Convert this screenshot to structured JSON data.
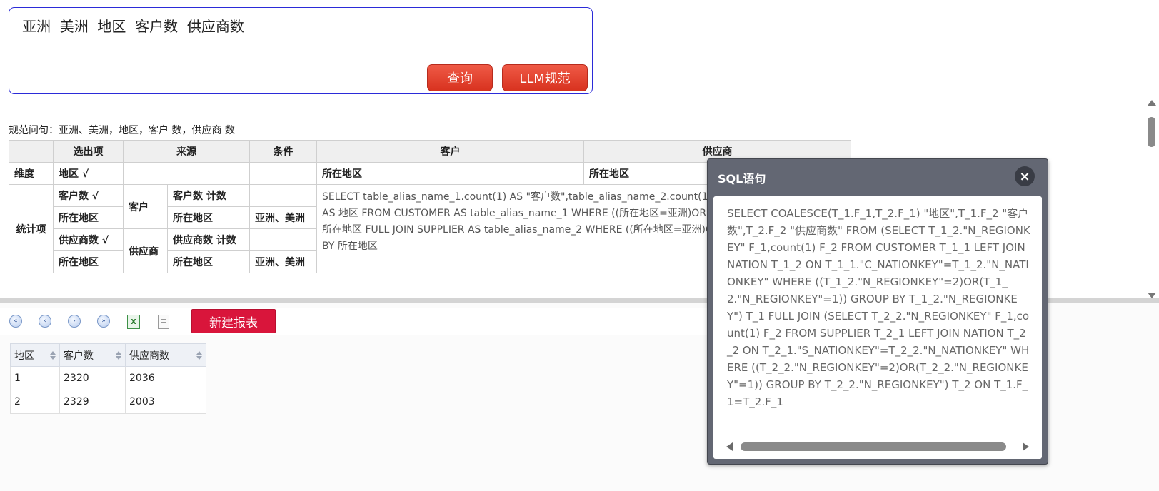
{
  "query": {
    "input_value": "亚洲  美洲  地区  客户数  供应商数",
    "query_button": "查询",
    "llm_button": "LLM规范"
  },
  "normalized": {
    "label": "规范问句：亚洲、美洲，地区，客户 数，供应商 数"
  },
  "grid": {
    "headers": [
      "选出项",
      "来源",
      "条件",
      "客户",
      "供应商"
    ],
    "dimension_label": "维度",
    "stats_label": "统计项",
    "dimension_row": {
      "select": "地区 √",
      "customer": "所在地区",
      "supplier": "所在地区"
    },
    "customer_label": "客户",
    "supplier_label": "供应商",
    "rows": [
      {
        "select": "客户数 √",
        "source": "客户数 计数",
        "condition": ""
      },
      {
        "select": "所在地区",
        "source": "所在地区",
        "condition": "亚洲、美洲"
      },
      {
        "select": "供应商数 √",
        "source": "供应商数 计数",
        "condition": ""
      },
      {
        "select": "所在地区",
        "source": "所在地区",
        "condition": "亚洲、美洲"
      }
    ],
    "sql_preview": "SELECT table_alias_name_1.count(1) AS \"客户数\",table_alias_name_2.count(1) AS \"供应商数\" ... REGION AS 地区 FROM CUSTOMER AS table_alias_name_1 WHERE ((所在地区=亚洲)OR(所在地区=美洲)) GROUP BY 所在地区 FULL JOIN SUPPLIER AS table_alias_name_2 WHERE ((所在地区=亚洲)OR(所在地区=美洲)) GROUP BY 所在地区"
  },
  "toolbar": {
    "new_report_button": "新建报表",
    "icons": [
      "first-page-icon",
      "prev-page-icon",
      "next-page-icon",
      "last-page-icon",
      "excel-export-icon",
      "document-icon"
    ]
  },
  "result_table": {
    "columns": [
      "地区",
      "客户数",
      "供应商数"
    ],
    "rows": [
      [
        "1",
        "2320",
        "2036"
      ],
      [
        "2",
        "2329",
        "2003"
      ]
    ]
  },
  "sql_dialog": {
    "title": "SQL语句",
    "close_glyph": "×",
    "sql": "SELECT COALESCE(T_1.F_1,T_2.F_1) \"地区\",T_1.F_2 \"客户数\",T_2.F_2 \"供应商数\" FROM (SELECT T_1_2.\"N_REGIONKEY\" F_1,count(1) F_2 FROM CUSTOMER T_1_1 LEFT JOIN NATION T_1_2 ON T_1_1.\"C_NATIONKEY\"=T_1_2.\"N_NATIONKEY\" WHERE ((T_1_2.\"N_REGIONKEY\"=2)OR(T_1_2.\"N_REGIONKEY\"=1)) GROUP BY T_1_2.\"N_REGIONKEY\") T_1 FULL JOIN (SELECT T_2_2.\"N_REGIONKEY\" F_1,count(1) F_2 FROM SUPPLIER T_2_1 LEFT JOIN NATION T_2_2 ON T_2_1.\"S_NATIONKEY\"=T_2_2.\"N_NATIONKEY\" WHERE ((T_2_2.\"N_REGIONKEY\"=2)OR(T_2_2.\"N_REGIONKEY\"=1)) GROUP BY T_2_2.\"N_REGIONKEY\") T_2 ON T_1.F_1=T_2.F_1"
  }
}
